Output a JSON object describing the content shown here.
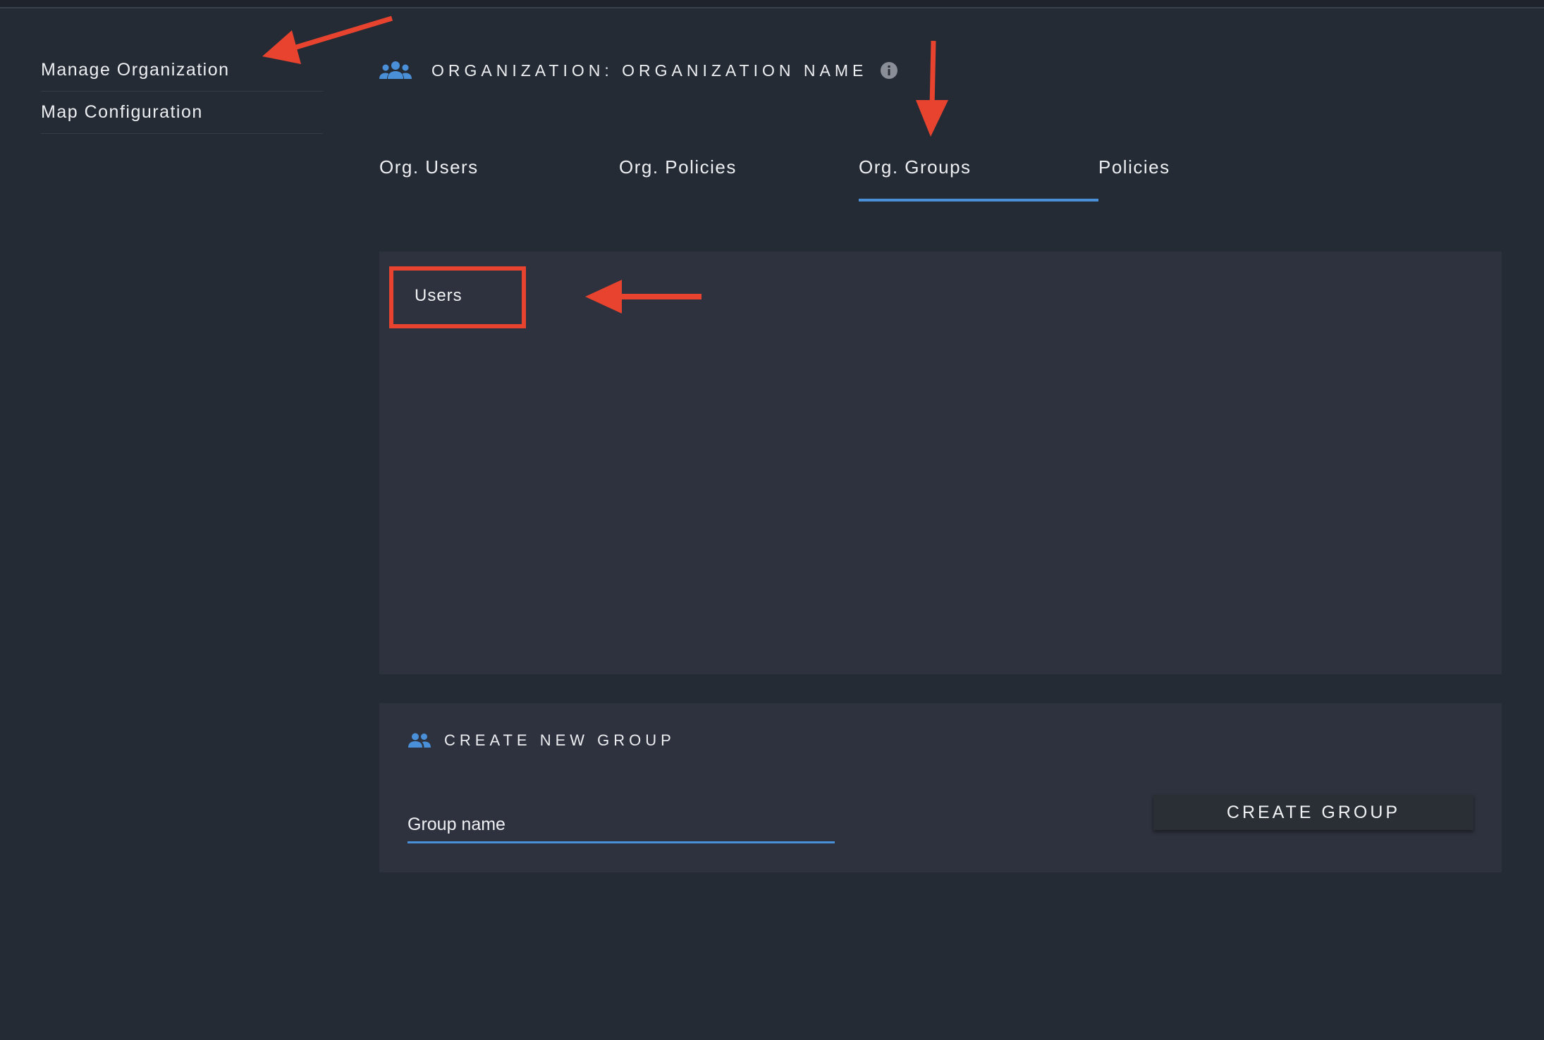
{
  "sidebar": {
    "items": [
      {
        "label": "Manage Organization"
      },
      {
        "label": "Map Configuration"
      }
    ]
  },
  "header": {
    "icon": "people-group-icon",
    "title": "ORGANIZATION: ORGANIZATION NAME",
    "info_icon": "info-icon"
  },
  "tabs": [
    {
      "label": "Org. Users"
    },
    {
      "label": "Org. Policies"
    },
    {
      "label": "Org. Groups",
      "active": true
    },
    {
      "label": "Policies"
    }
  ],
  "groups": {
    "items": [
      {
        "label": "Users"
      }
    ]
  },
  "create_group": {
    "icon": "group-icon",
    "title": "CREATE NEW GROUP",
    "input_placeholder": "Group name",
    "input_value": "",
    "button_label": "CREATE GROUP"
  },
  "colors": {
    "background": "#252b35",
    "panel": "#2e323e",
    "accent": "#4a90d9",
    "annotation": "#e8432e"
  }
}
